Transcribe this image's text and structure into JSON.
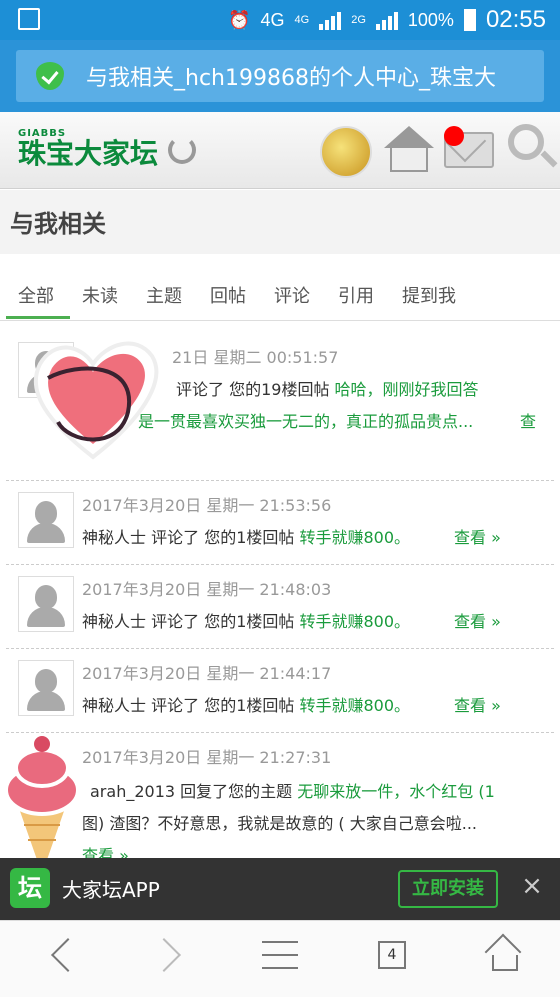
{
  "status_bar": {
    "network": "4G",
    "net1": "4G",
    "net2": "2G",
    "battery": "100%",
    "time": "02:55"
  },
  "browser": {
    "page_title": "与我相关_hch199868的个人中心_珠宝大"
  },
  "site": {
    "logo_small": "GIABBS",
    "logo_big": "珠宝大家坛"
  },
  "page": {
    "heading": "与我相关"
  },
  "tabs": [
    {
      "label": "全部",
      "active": true
    },
    {
      "label": "未读"
    },
    {
      "label": "主题"
    },
    {
      "label": "回帖"
    },
    {
      "label": "评论"
    },
    {
      "label": "引用"
    },
    {
      "label": "提到我"
    }
  ],
  "notifications": [
    {
      "time": "21日 星期二 00:51:57",
      "action": "评论了 您的19楼回帖",
      "content": "哈哈，刚刚好我回答",
      "line2": "是一贯最喜欢买独一无二的，真正的孤品贵点...",
      "view": "查"
    },
    {
      "time": "2017年3月20日 星期一 21:53:56",
      "user": "神秘人士",
      "action": "评论了 您的1楼回帖",
      "content": "转手就赚800。",
      "view": "查看 »"
    },
    {
      "time": "2017年3月20日 星期一 21:48:03",
      "user": "神秘人士",
      "action": "评论了 您的1楼回帖",
      "content": "转手就赚800。",
      "view": "查看 »"
    },
    {
      "time": "2017年3月20日 星期一 21:44:17",
      "user": "神秘人士",
      "action": "评论了 您的1楼回帖",
      "content": "转手就赚800。",
      "view": "查看 »"
    },
    {
      "time": "2017年3月20日 星期一 21:27:31",
      "user": "arah_2013",
      "action": "回复了您的主题",
      "content": "无聊来放一件，水个红包 (1",
      "line2": "图) 渣图？不好意思，我就是故意的 ( 大家自己意会啦...",
      "view": "查看 »"
    }
  ],
  "app_banner": {
    "logo": "坛",
    "name": "大家坛APP",
    "install": "立即安装",
    "close": "×"
  },
  "bottom_nav": {
    "tab_count": "4"
  }
}
